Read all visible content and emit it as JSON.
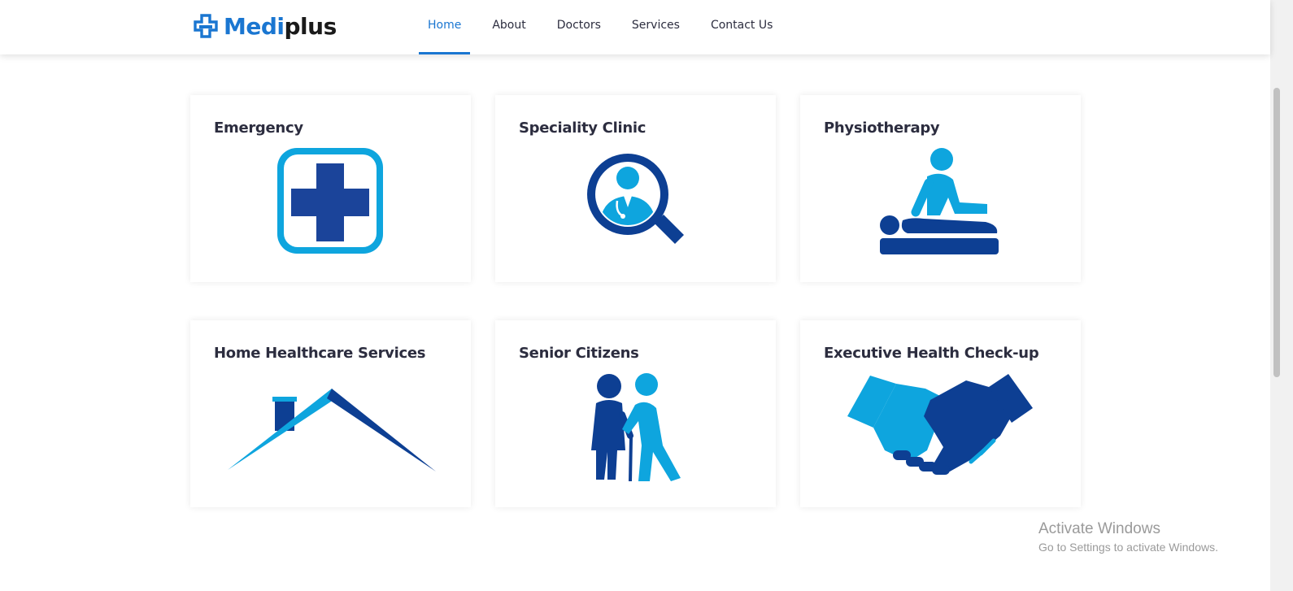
{
  "brand": {
    "prefix": "Medi",
    "suffix": "plus"
  },
  "nav": {
    "items": [
      {
        "label": "Home",
        "active": true
      },
      {
        "label": "About"
      },
      {
        "label": "Doctors"
      },
      {
        "label": "Services"
      },
      {
        "label": "Contact Us"
      }
    ]
  },
  "services": [
    {
      "title": "Emergency",
      "icon": "medical-cross-icon"
    },
    {
      "title": "Speciality Clinic",
      "icon": "doctor-search-icon"
    },
    {
      "title": "Physiotherapy",
      "icon": "physiotherapy-icon"
    },
    {
      "title": "Home Healthcare Services",
      "icon": "house-roof-icon"
    },
    {
      "title": "Senior Citizens",
      "icon": "senior-citizens-icon"
    },
    {
      "title": "Executive Health Check-up",
      "icon": "handshake-icon"
    }
  ],
  "watermark": {
    "title": "Activate Windows",
    "subtitle": "Go to Settings to activate Windows."
  },
  "colors": {
    "accent": "#1a76d1",
    "dark_blue": "#0d3f93",
    "light_blue": "#0ea5de"
  }
}
